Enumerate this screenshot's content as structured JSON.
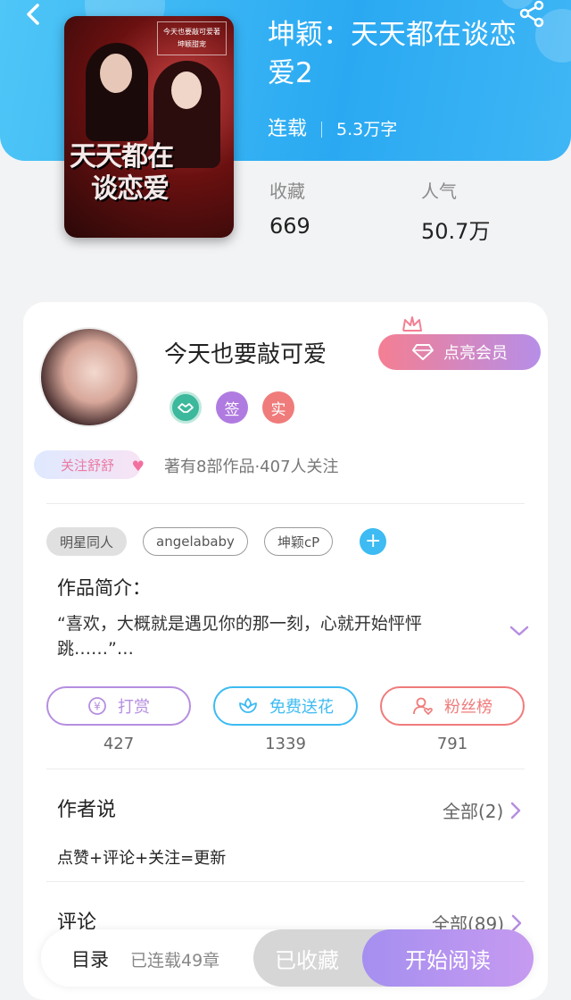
{
  "header": {
    "book_title": "坤颖：天天都在谈恋爱2",
    "status": "连载",
    "word_count": "5.3万字"
  },
  "cover": {
    "badge_line1": "今天也要敲可爱著",
    "badge_line2": "坤颖甜宠",
    "title_line1": "天天都在",
    "title_line2": "谈恋爱"
  },
  "stats": {
    "favorites_label": "收藏",
    "favorites_value": "669",
    "popularity_label": "人气",
    "popularity_value": "50.7万"
  },
  "author": {
    "name": "今天也要敲可爱",
    "vip_label": "点亮会员",
    "badge_sign": "签",
    "badge_real": "实",
    "follow_label": "关注舒舒",
    "works_info": "著有8部作品·407人关注"
  },
  "tags": [
    "明星同人",
    "angelababy",
    "坤颖cP"
  ],
  "tag_add": "+",
  "intro": {
    "title": "作品简介：",
    "text": "“喜欢，大概就是遇见你的那一刻，心就开始怦怦跳……”…"
  },
  "actions": [
    {
      "label": "打赏",
      "count": "427",
      "color": "#b68ee0"
    },
    {
      "label": "免费送花",
      "count": "1339",
      "color": "#3dbbf2"
    },
    {
      "label": "粉丝榜",
      "count": "791",
      "color": "#f07b7b"
    }
  ],
  "author_says": {
    "title": "作者说",
    "more": "全部(2)",
    "note": "点赞+评论+关注=更新"
  },
  "comments": {
    "title": "评论",
    "more": "全部(89)"
  },
  "bottom_bar": {
    "toc": "目录",
    "chapters": "已连载49章",
    "collected": "已收藏",
    "start_reading": "开始阅读"
  }
}
